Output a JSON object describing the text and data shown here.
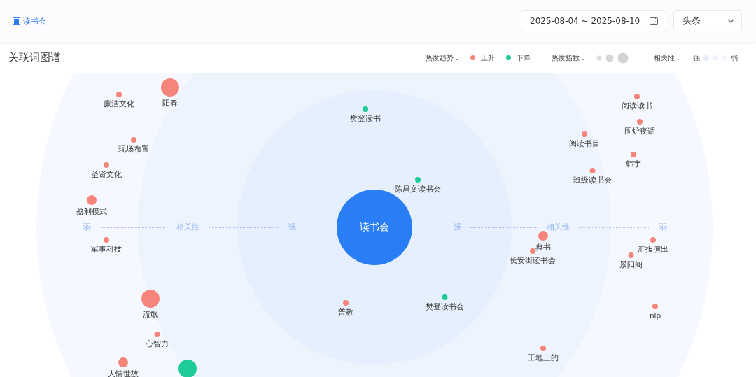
{
  "header": {
    "topic": "读书会",
    "date_range": "2025-08-04 ~ 2025-08-10",
    "source": "头条"
  },
  "section": {
    "title": "关联词图谱"
  },
  "legend": {
    "trend_label": "热度趋势：",
    "trend_items": [
      {
        "label": "上升",
        "color": "#f5857b"
      },
      {
        "label": "下降",
        "color": "#1ccb98"
      }
    ],
    "heat_label": "热度指数：",
    "relevance_label": "相关性：",
    "relevance_strong": "强",
    "relevance_weak": "弱"
  },
  "graph": {
    "center": "读书会",
    "axis_left": [
      "弱",
      "相关性",
      "强"
    ],
    "axis_right": [
      "强",
      "相关性",
      "弱"
    ],
    "nodes": [
      {
        "label": "廉洁文化",
        "rising": true,
        "kind": "small"
      },
      {
        "label": "阳春",
        "rising": true,
        "kind": "large"
      },
      {
        "label": "樊登读书",
        "rising": false,
        "kind": "small"
      },
      {
        "label": "现场布置",
        "rising": true,
        "kind": "small"
      },
      {
        "label": "圣贤文化",
        "rising": true,
        "kind": "small"
      },
      {
        "label": "盈利模式",
        "rising": true,
        "kind": "medium"
      },
      {
        "label": "军事科技",
        "rising": true,
        "kind": "small"
      },
      {
        "label": "陈昌文读书会",
        "rising": false,
        "kind": "small"
      },
      {
        "label": "流氓",
        "rising": true,
        "kind": "large"
      },
      {
        "label": "心智力",
        "rising": true,
        "kind": "small"
      },
      {
        "label": "人情世故",
        "rising": true,
        "kind": "medium"
      },
      {
        "rising": false,
        "kind": "large"
      },
      {
        "label": "普教",
        "rising": true,
        "kind": "small"
      },
      {
        "label": "樊登读书会",
        "rising": false,
        "kind": "small"
      },
      {
        "label": "阅读读书",
        "rising": true,
        "kind": "small"
      },
      {
        "label": "围炉夜话",
        "rising": true,
        "kind": "small"
      },
      {
        "label": "阅读书目",
        "rising": true,
        "kind": "small"
      },
      {
        "label": "韩宇",
        "rising": true,
        "kind": "small"
      },
      {
        "label": "班级读书会",
        "rising": true,
        "kind": "small"
      },
      {
        "label": "典书",
        "rising": true,
        "kind": "medium"
      },
      {
        "label": "长安街读书会",
        "rising": true,
        "kind": "small"
      },
      {
        "label": "汇报演出",
        "rising": true,
        "kind": "small"
      },
      {
        "label": "景阳阁",
        "rising": true,
        "kind": "small"
      },
      {
        "label": "nlp",
        "rising": true,
        "kind": "small"
      },
      {
        "label": "工地上的",
        "rising": true,
        "kind": "small"
      }
    ]
  }
}
